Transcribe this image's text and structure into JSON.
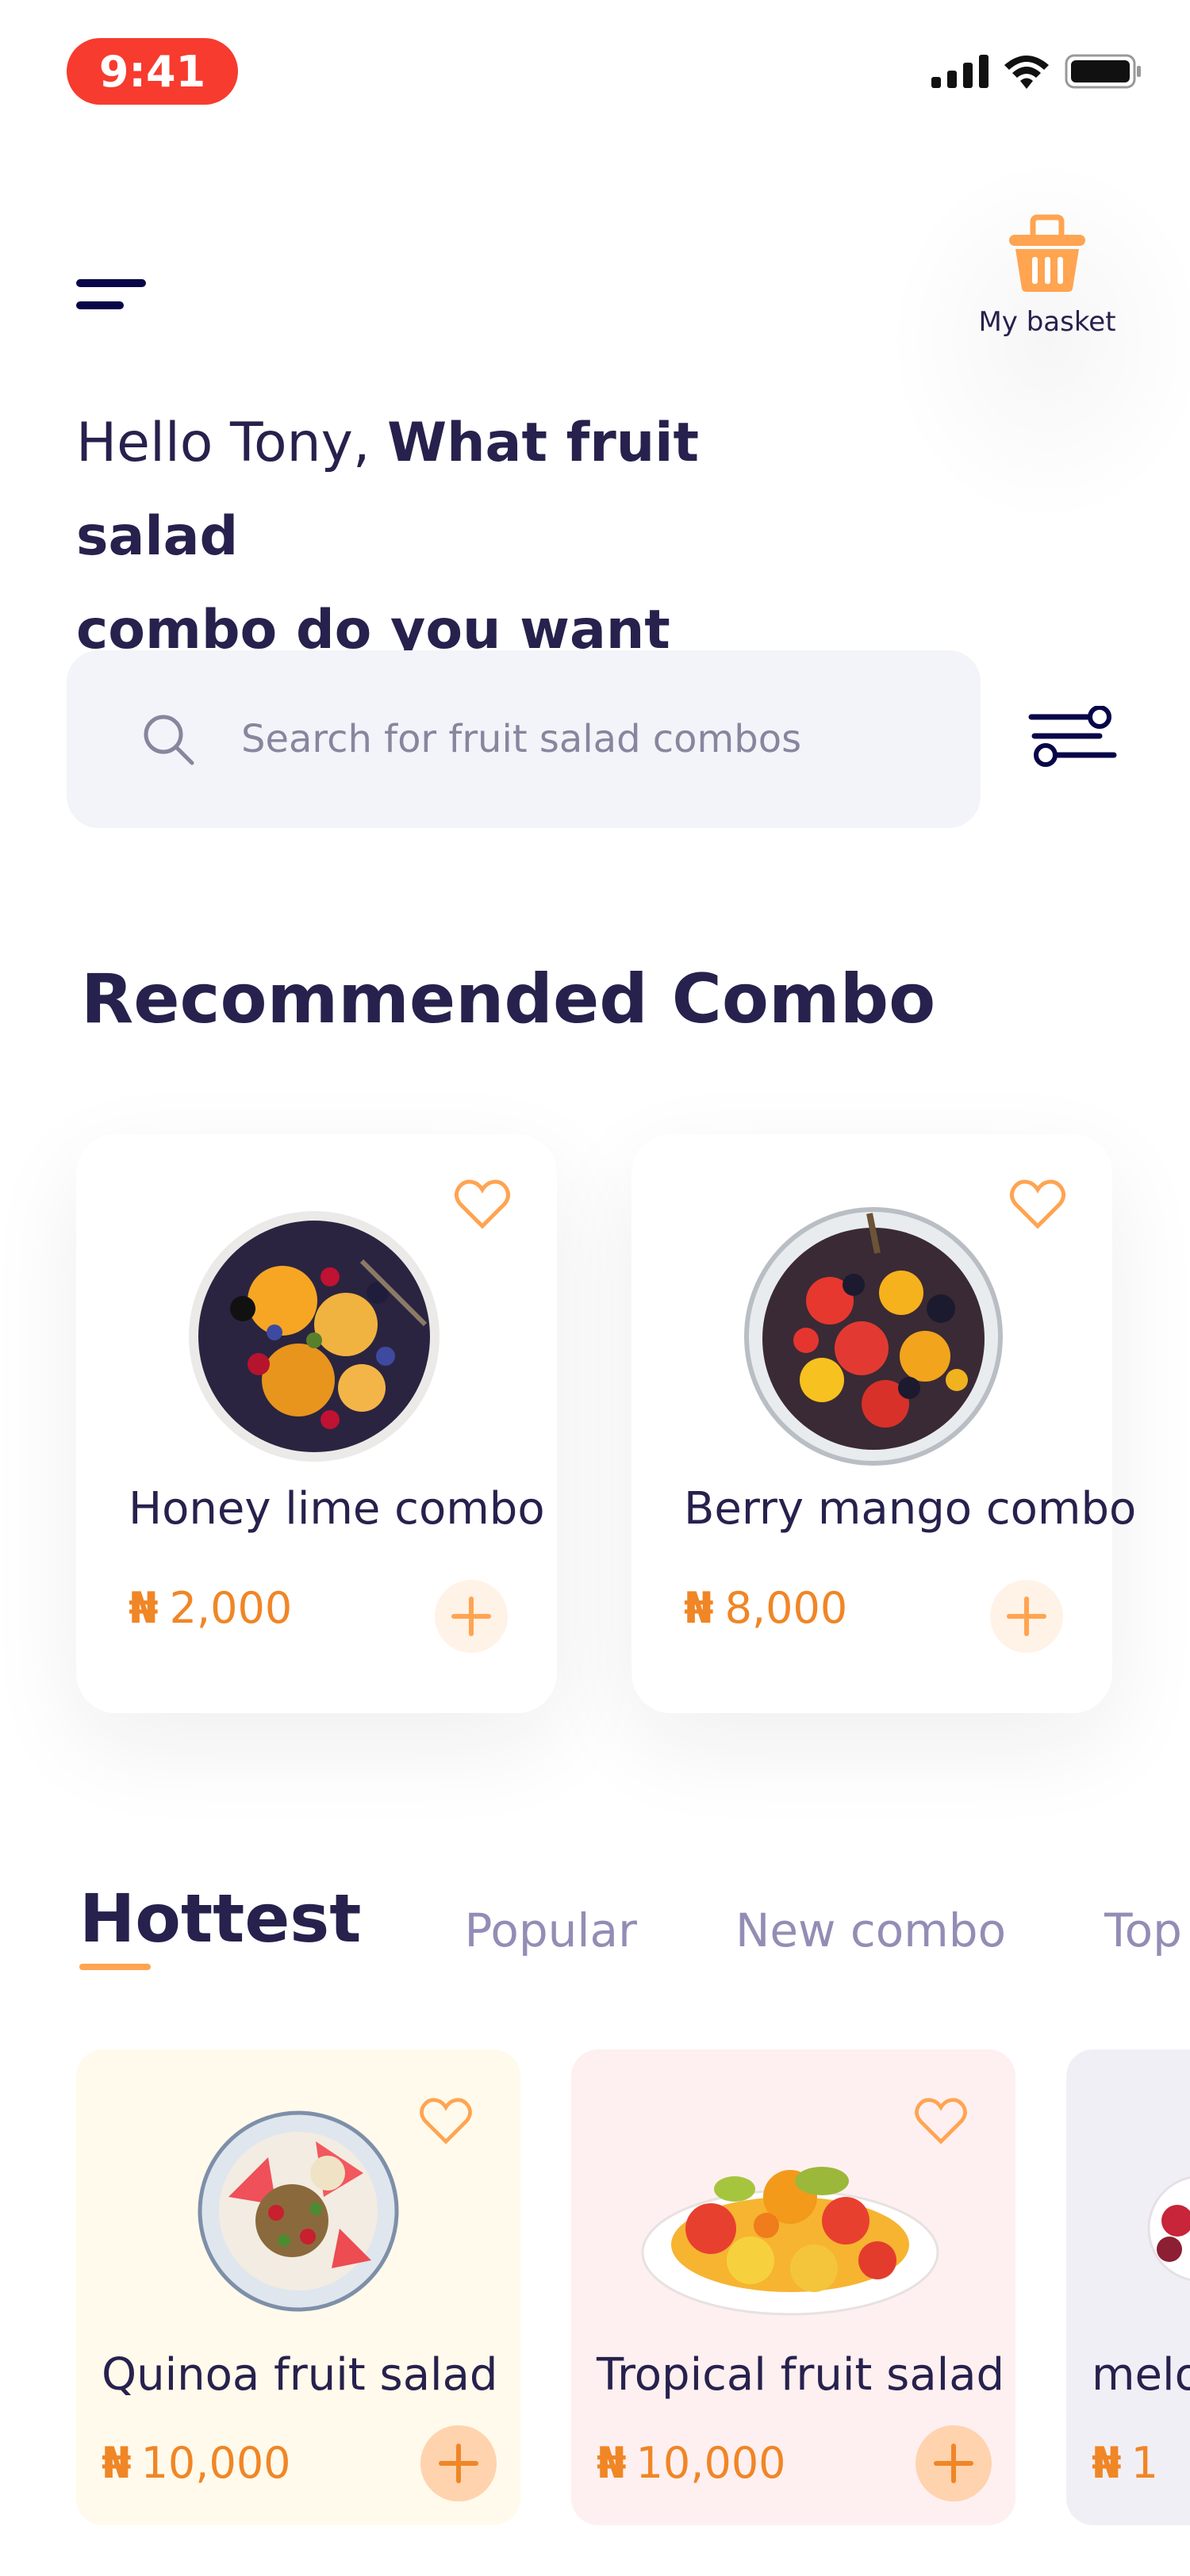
{
  "status_bar": {
    "time": "9:41"
  },
  "header": {
    "basket_label": "My basket"
  },
  "greeting": {
    "hello": "Hello Tony,",
    "question_line1": "What fruit salad",
    "question_line2": "combo do you want today?"
  },
  "search": {
    "placeholder": "Search for fruit salad combos"
  },
  "recommended": {
    "title": "Recommended Combo",
    "items": [
      {
        "name": "Honey lime combo",
        "currency": "₦",
        "price": "2,000"
      },
      {
        "name": "Berry mango combo",
        "currency": "₦",
        "price": "8,000"
      }
    ]
  },
  "tabs": [
    {
      "label": "Hottest",
      "active": true
    },
    {
      "label": "Popular"
    },
    {
      "label": "New combo"
    },
    {
      "label": "Top"
    }
  ],
  "hottest": [
    {
      "name": "Quinoa fruit salad",
      "currency": "₦",
      "price": "10,000",
      "bg": "#FFFAEB"
    },
    {
      "name": "Tropical fruit salad",
      "currency": "₦",
      "price": "10,000",
      "bg": "#FEF0F0"
    },
    {
      "name": "melo",
      "currency": "₦",
      "price": "1",
      "bg": "#F1EFF6"
    }
  ],
  "colors": {
    "accent": "#FFA451",
    "price": "#F08626",
    "text_dark": "#27214D",
    "time_pill": "#F73B2E"
  }
}
